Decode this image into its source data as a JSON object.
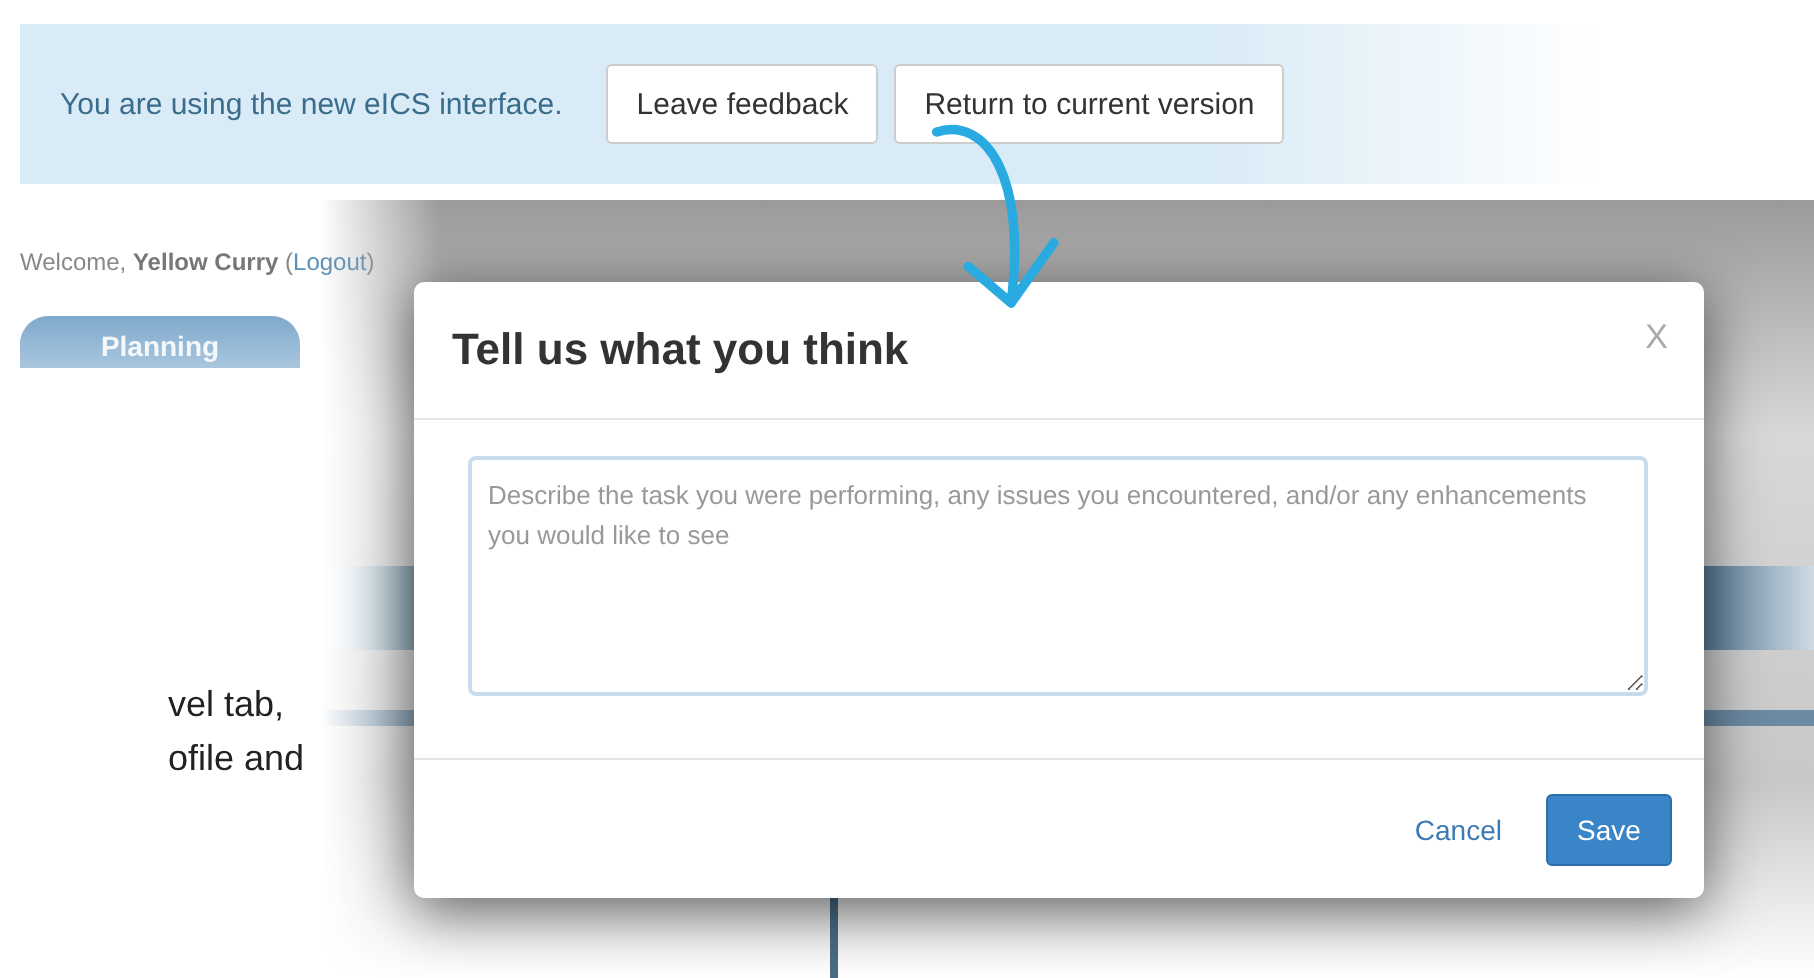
{
  "banner": {
    "message": "You are using the new eICS interface.",
    "buttons": [
      {
        "label": "Leave feedback"
      },
      {
        "label": "Return to current version"
      }
    ]
  },
  "background_page": {
    "welcome": {
      "before": "Welcome, **Yellow Curry** (",
      "link": "Logout",
      "after": ")"
    },
    "tabs": [
      {
        "label": "Planning",
        "selected": true
      }
    ],
    "text_fragments": [
      "vel tab,",
      "ofile and"
    ]
  },
  "modal": {
    "title": "Tell us what you think",
    "close": "X",
    "textarea": {
      "placeholder": "Describe the task you were performing, any issues you encountered, and/or any enhancements you would like to see"
    },
    "buttons": [
      {
        "label": "Cancel",
        "kind": "link"
      },
      {
        "label": "Save",
        "kind": "primary"
      }
    ]
  }
}
